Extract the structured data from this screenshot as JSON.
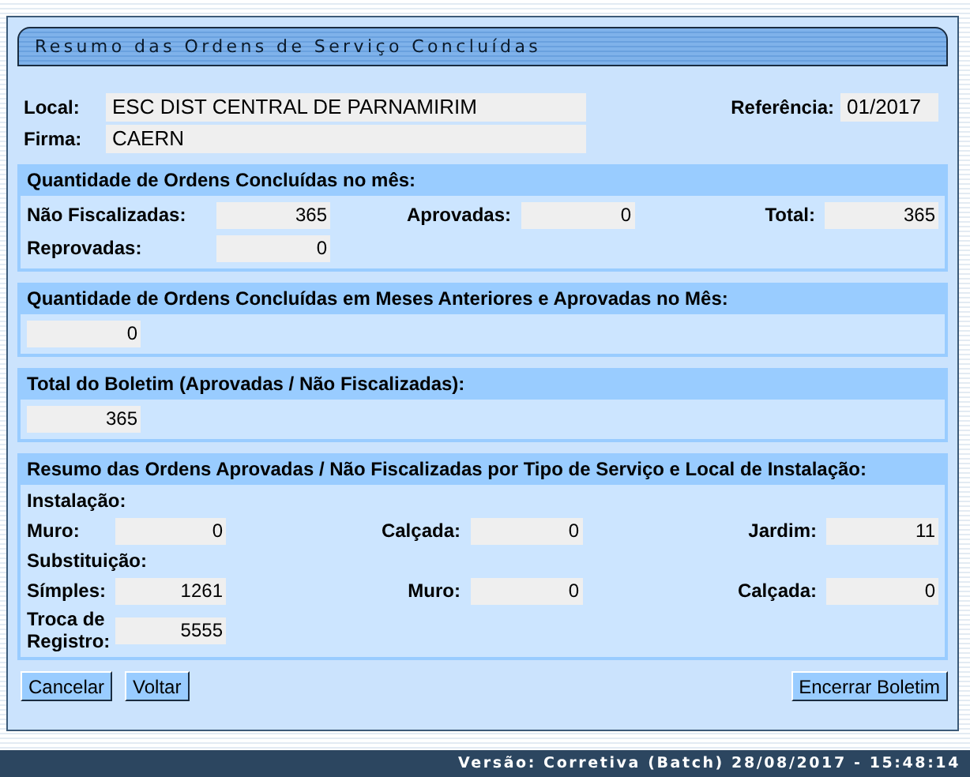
{
  "header": {
    "title": "Resumo das Ordens de Serviço Concluídas"
  },
  "info": {
    "fields": [
      {
        "label": "Local:",
        "value": "ESC DIST CENTRAL DE PARNAMIRIM"
      },
      {
        "label": "Firma:",
        "value": "CAERN"
      }
    ],
    "reference": {
      "label": "Referência:",
      "value": "01/2017"
    }
  },
  "sections": [
    {
      "title": "Quantidade de Ordens Concluídas no mês:",
      "kind": "three",
      "rows": [
        {
          "kind": "fields",
          "fields": [
            {
              "label": "Não Fiscalizadas:",
              "value": "365"
            },
            {
              "label": "Aprovadas:",
              "value": "0"
            },
            {
              "label": "Total:",
              "value": "365"
            }
          ]
        },
        {
          "kind": "fields",
          "fields": [
            {
              "label": "Reprovadas:",
              "value": "0"
            }
          ]
        }
      ]
    },
    {
      "title": "Quantidade de Ordens Concluídas em Meses Anteriores e Aprovadas no Mês:",
      "kind": "single",
      "rows": [
        {
          "kind": "fields",
          "fields": [
            {
              "value": "0"
            }
          ]
        }
      ]
    },
    {
      "title": "Total do Boletim (Aprovadas / Não Fiscalizadas):",
      "kind": "single",
      "rows": [
        {
          "kind": "fields",
          "fields": [
            {
              "value": "365"
            }
          ]
        }
      ]
    },
    {
      "title": "Resumo das Ordens Aprovadas / Não Fiscalizadas por Tipo de Serviço e Local de Instalação:",
      "kind": "three-narrow",
      "rows": [
        {
          "kind": "heading",
          "text": "Instalação:"
        },
        {
          "kind": "fields",
          "fields": [
            {
              "label": "Muro:",
              "value": "0"
            },
            {
              "label": "Calçada:",
              "value": "0"
            },
            {
              "label": "Jardim:",
              "value": "11"
            }
          ]
        },
        {
          "kind": "heading",
          "text": "Substituição:"
        },
        {
          "kind": "fields",
          "fields": [
            {
              "label": "Símples:",
              "value": "1261"
            },
            {
              "label": "Muro:",
              "value": "0"
            },
            {
              "label": "Calçada:",
              "value": "0"
            }
          ]
        },
        {
          "kind": "fields",
          "fields": [
            {
              "label": "Troca de Registro:",
              "value": "5555"
            }
          ]
        }
      ]
    }
  ],
  "buttons_left": [
    "Cancelar",
    "Voltar"
  ],
  "buttons_right": [
    "Encerrar Boletim"
  ],
  "footer": {
    "version": "Versão: Corretiva (Batch) 28/08/2017 - 15:48:14"
  }
}
